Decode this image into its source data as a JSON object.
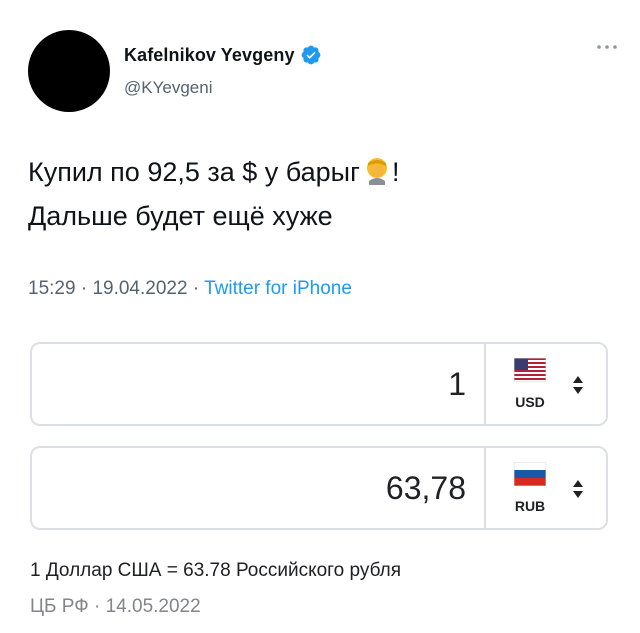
{
  "tweet": {
    "name": "Kafelnikov Yevgeny",
    "handle": "@KYevgeni",
    "more_icon": "more-icon",
    "text_line1": "Купил по 92,5 за $ у барыг",
    "text_line1_end": "!",
    "text_line2": "Дальше будет ещё хуже",
    "emoji": "facepalm-emoji",
    "time": "15:29",
    "date": "19.04.2022",
    "separator": "·",
    "source": "Twitter for iPhone",
    "colors": {
      "link": "#1d9bf0",
      "muted": "#536471",
      "verified": "#1d9bf0"
    }
  },
  "converter": {
    "from": {
      "amount": "1",
      "code": "USD",
      "flag_icon": "us-flag-icon"
    },
    "to": {
      "amount": "63,78",
      "code": "RUB",
      "flag_icon": "ru-flag-icon"
    },
    "rate_text": "1 Доллар США = 63.78 Российского рубля",
    "source_text": "ЦБ РФ · 14.05.2022"
  }
}
